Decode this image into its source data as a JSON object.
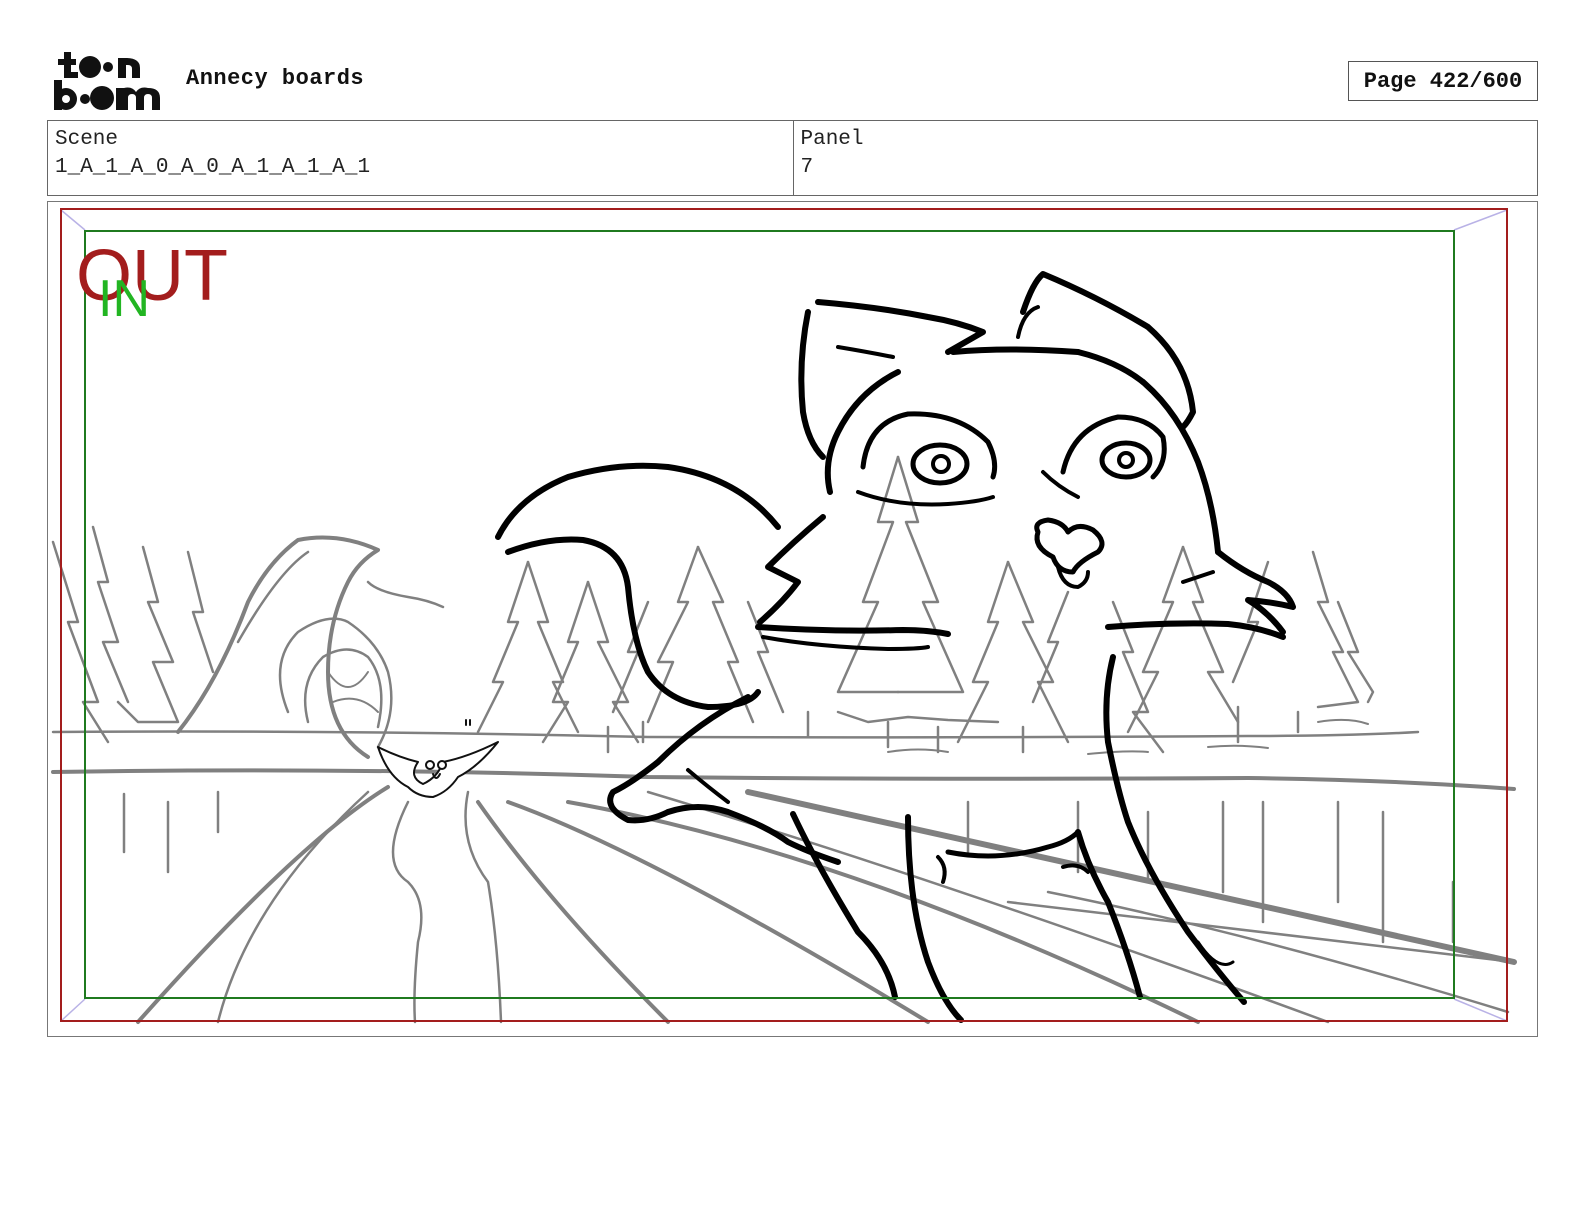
{
  "header": {
    "logo": {
      "line1": "toon",
      "line2": "boom"
    },
    "title": "Annecy boards",
    "page_label": "Page 422/600"
  },
  "info": {
    "scene_label": "Scene",
    "scene_value": "1_A_1_A_0_A_0_A_1_A_1_A_1",
    "panel_label": "Panel",
    "panel_value": "7"
  },
  "panel": {
    "out_label": "OUT",
    "in_label": "IN",
    "colors": {
      "out_frame": "#a31d1d",
      "in_frame": "#1f7a1f",
      "in_text": "#22b522",
      "guide": "#b9b2e6",
      "background_lines": "#808080",
      "character_lines": "#000000"
    }
  }
}
